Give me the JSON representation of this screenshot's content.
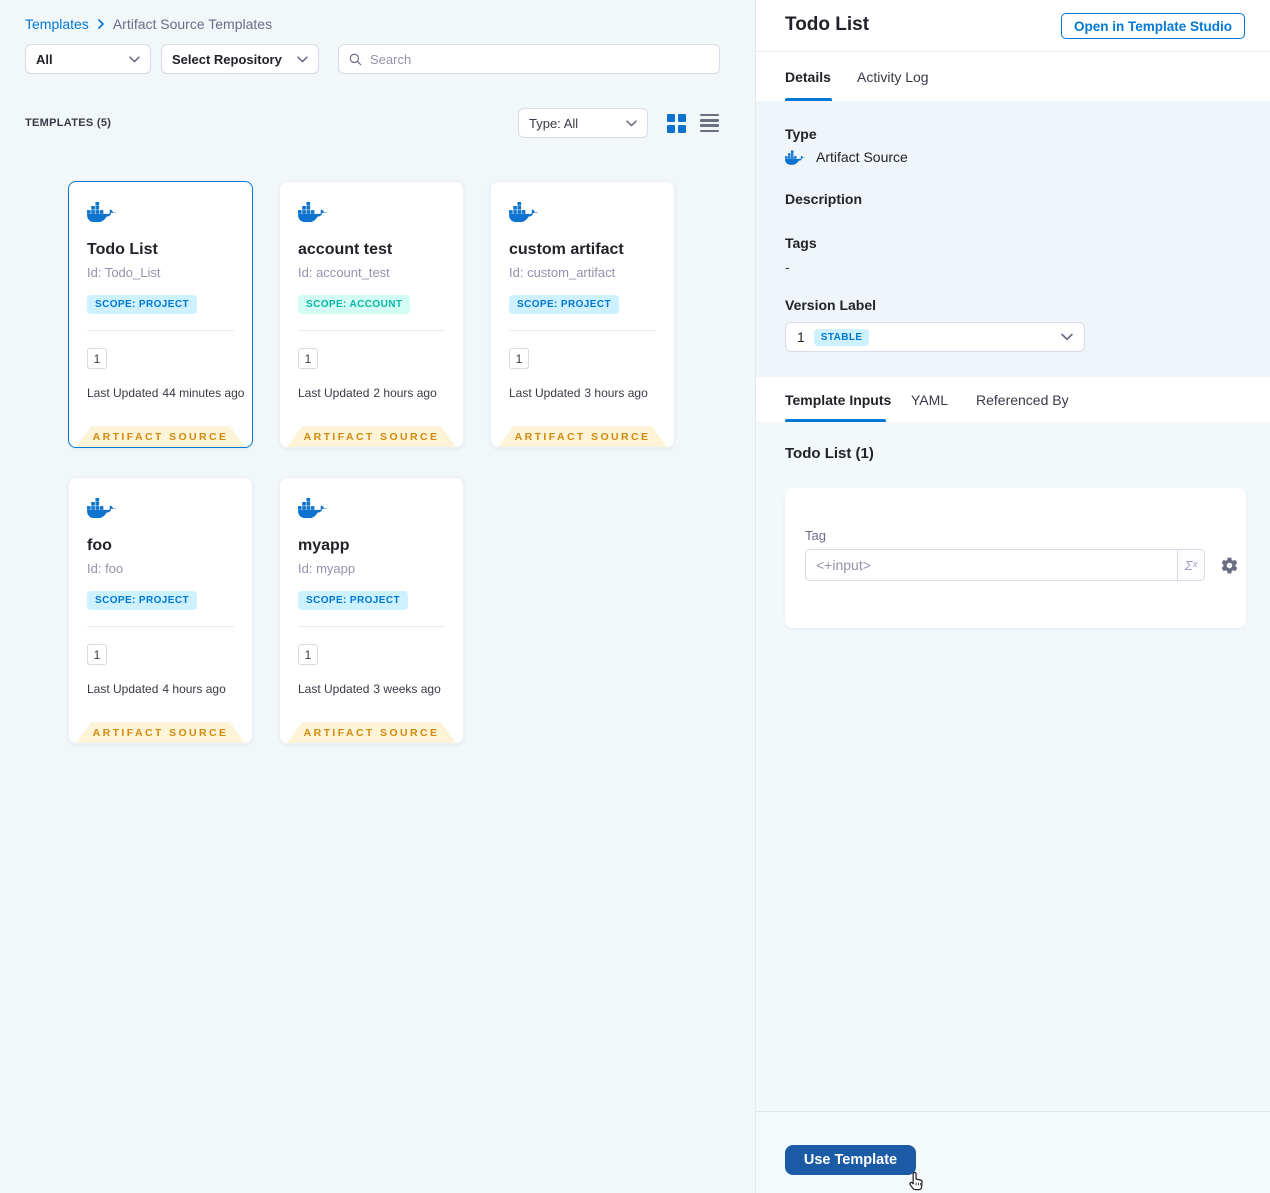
{
  "breadcrumb": {
    "root": "Templates",
    "current": "Artifact Source Templates"
  },
  "filters": {
    "scope": "All",
    "repository": "Select Repository",
    "search_placeholder": "Search"
  },
  "list_header": {
    "count": "TEMPLATES (5)",
    "type_filter": "Type: All"
  },
  "labels": {
    "last_updated": "Last Updated",
    "artifact_source": "ARTIFACT SOURCE"
  },
  "cards": [
    {
      "title": "Todo List",
      "id": "Id: Todo_List",
      "scope": "SCOPE: PROJECT",
      "version": "1",
      "updated": "44 minutes ago"
    },
    {
      "title": "account test",
      "id": "Id: account_test",
      "scope": "SCOPE: ACCOUNT",
      "version": "1",
      "updated": "2 hours ago"
    },
    {
      "title": "custom artifact",
      "id": "Id: custom_artifact",
      "scope": "SCOPE: PROJECT",
      "version": "1",
      "updated": "3 hours ago"
    },
    {
      "title": "foo",
      "id": "Id: foo",
      "scope": "SCOPE: PROJECT",
      "version": "1",
      "updated": "4 hours ago"
    },
    {
      "title": "myapp",
      "id": "Id: myapp",
      "scope": "SCOPE: PROJECT",
      "version": "1",
      "updated": "3 weeks ago"
    }
  ],
  "panel": {
    "title": "Todo List",
    "open_in_studio": "Open in Template Studio",
    "tabs": {
      "details": "Details",
      "activity_log": "Activity Log"
    },
    "details": {
      "type_label": "Type",
      "type_value": "Artifact Source",
      "description_label": "Description",
      "tags_label": "Tags",
      "tags_value": "-",
      "version_label": "Version Label",
      "version_number": "1",
      "version_badge": "STABLE"
    },
    "inner_tabs": {
      "template_inputs": "Template Inputs",
      "yaml": "YAML",
      "referenced_by": "Referenced By"
    },
    "inputs": {
      "heading": "Todo List (1)",
      "tag_label": "Tag",
      "tag_value": "<+input>",
      "expression": "Σˣ"
    },
    "use_template": "Use Template"
  },
  "colors": {
    "accent": "#0278d5",
    "primary_button": "#1b5aa5",
    "ribbon_bg": "#fdf4d8",
    "ribbon_text": "#d4880e",
    "badge_project_bg": "#cdf1fe",
    "badge_project_text": "#0278d5",
    "badge_account_bg": "#d3fcf4",
    "badge_account_text": "#0ab6a6",
    "stable_bg": "#cdf1fe",
    "stable_text": "#0278d5"
  }
}
